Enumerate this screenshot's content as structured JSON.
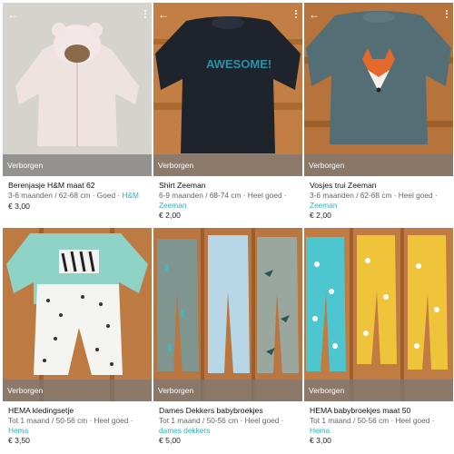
{
  "items": [
    {
      "status": "Verborgen",
      "title": "Berenjasje H&M maat 62",
      "meta": "3-6 maanden / 62-68 cm · Goed ·",
      "brand": "H&M",
      "price": "€ 3,00"
    },
    {
      "status": "Verborgen",
      "title": "Shirt Zeeman",
      "meta": "6-9 maanden / 68-74 cm · Heel goed ·",
      "brand": "Zeeman",
      "price": "€ 2,00"
    },
    {
      "status": "Verborgen",
      "title": "Vosjes trui Zeeman",
      "meta": "3-6 maanden / 62-68 cm · Heel goed ·",
      "brand": "Zeeman",
      "price": "€ 2,00"
    },
    {
      "status": "Verborgen",
      "title": "HEMA kledingsetje",
      "meta": "Tot 1 maand / 50-56 cm · Heel goed ·",
      "brand": "Hema",
      "price": "€ 3,50"
    },
    {
      "status": "Verborgen",
      "title": "Dames Dekkers babybroekjes",
      "meta": "Tot 1 maand / 50-56 cm · Heel goed ·",
      "brand": "dames dekkers",
      "price": "€ 5,00"
    },
    {
      "status": "Verborgen",
      "title": "HEMA babybroekjes maat 50",
      "meta": "Tot 1 maand / 50-56 cm · Heel goed ·",
      "brand": "Hema",
      "price": "€ 3,00"
    }
  ],
  "photo_text": {
    "shirt_print": "AWESOME!"
  },
  "icons": {
    "back": "back-arrow-icon",
    "more": "more-vertical-icon"
  },
  "colors": {
    "brand_link": "#2bb0c0",
    "overlay": "#787878"
  }
}
